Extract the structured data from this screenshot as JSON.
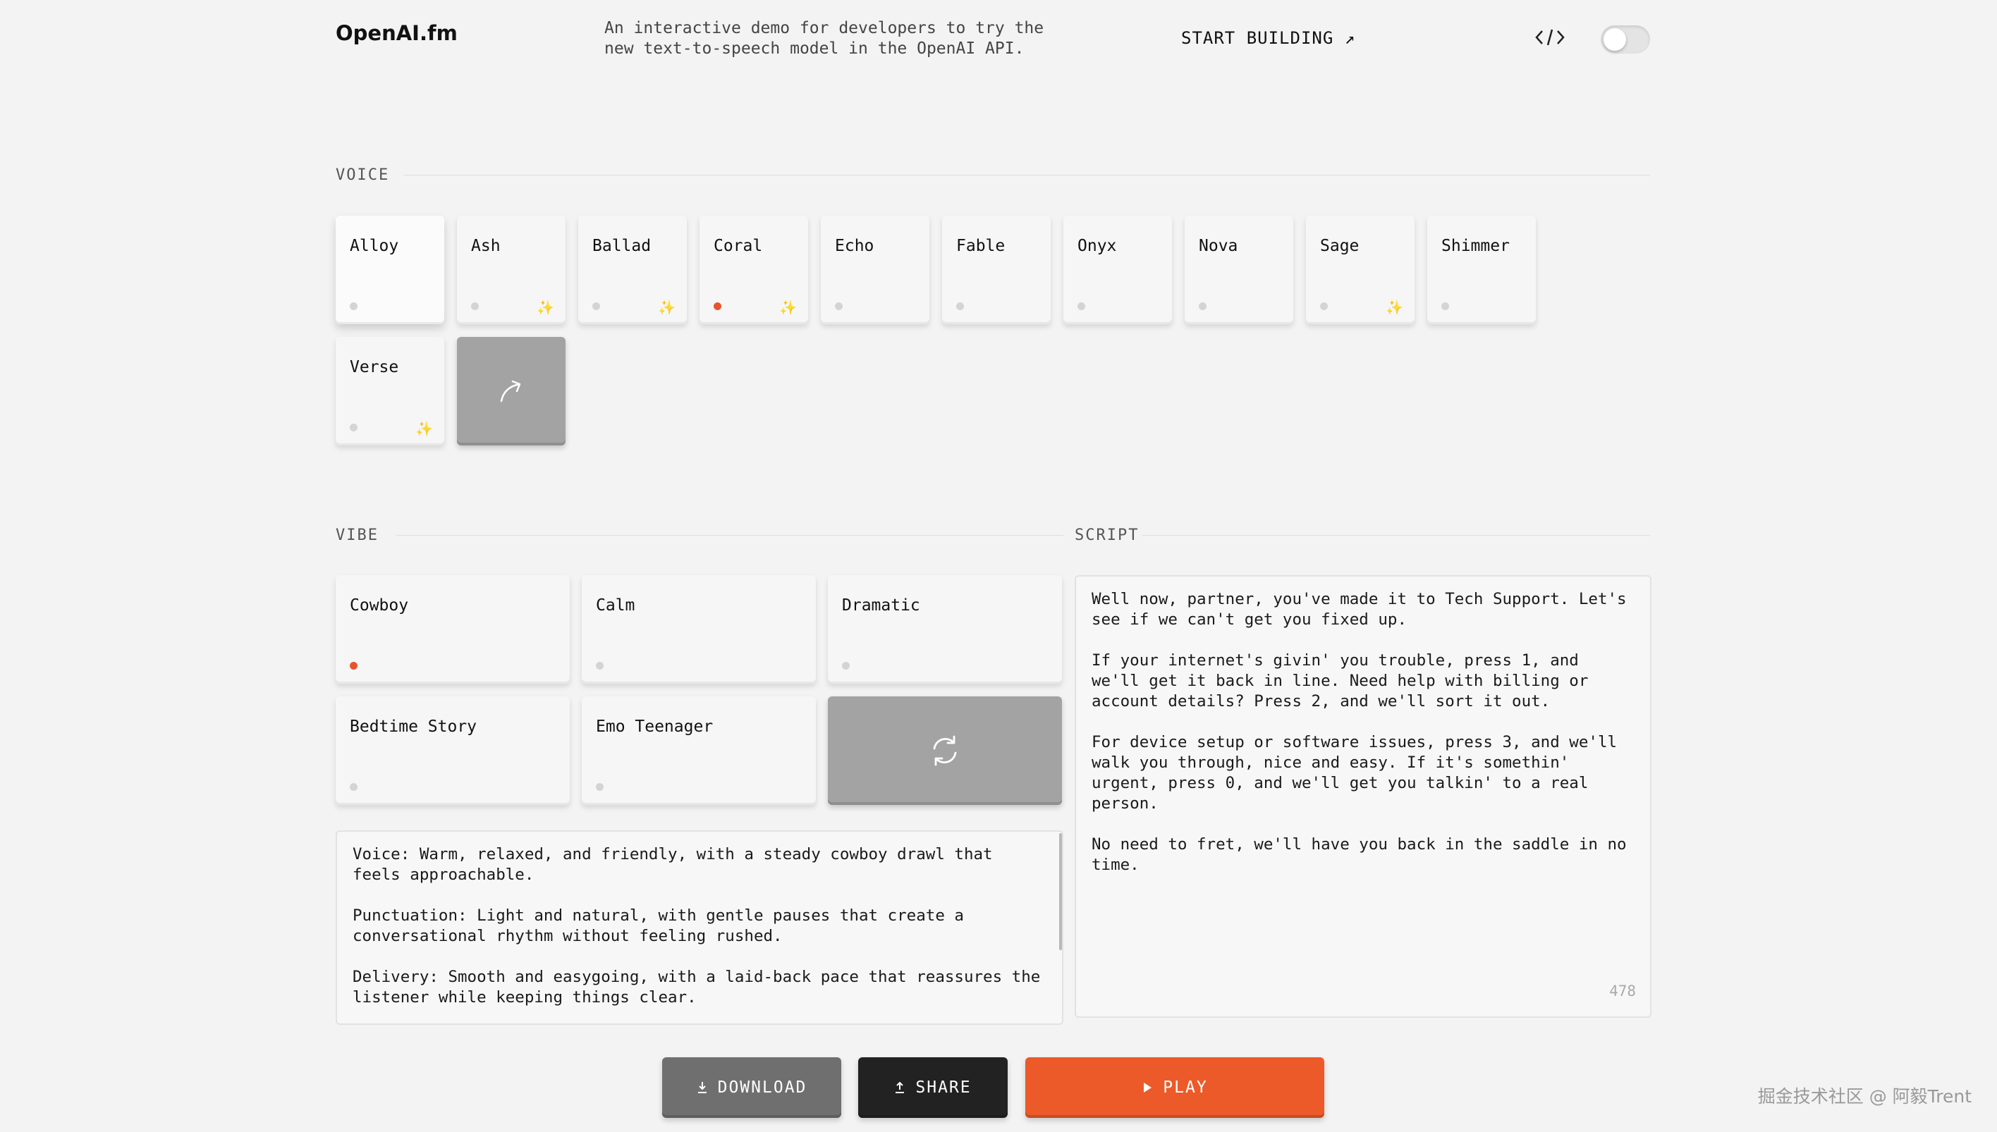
{
  "header": {
    "logo": "OpenAI.fm",
    "tagline": "An interactive demo for developers to try the new text-to-speech model in the OpenAI API.",
    "start_building": "START BUILDING ↗",
    "code_icon": "code-icon",
    "theme_toggle_on": false
  },
  "voice": {
    "label": "VOICE",
    "items": [
      {
        "name": "Alloy",
        "active": false,
        "sparkle": false,
        "selected": true
      },
      {
        "name": "Ash",
        "active": false,
        "sparkle": true
      },
      {
        "name": "Ballad",
        "active": false,
        "sparkle": true
      },
      {
        "name": "Coral",
        "active": true,
        "sparkle": true
      },
      {
        "name": "Echo",
        "active": false,
        "sparkle": false
      },
      {
        "name": "Fable",
        "active": false,
        "sparkle": false
      },
      {
        "name": "Onyx",
        "active": false,
        "sparkle": false
      },
      {
        "name": "Nova",
        "active": false,
        "sparkle": false
      },
      {
        "name": "Sage",
        "active": false,
        "sparkle": true
      },
      {
        "name": "Shimmer",
        "active": false,
        "sparkle": false
      },
      {
        "name": "Verse",
        "active": false,
        "sparkle": true
      }
    ],
    "more_icon": "arrow-up-right-icon",
    "sparkle_glyph": "✨"
  },
  "vibe": {
    "label": "VIBE",
    "items": [
      {
        "name": "Cowboy",
        "active": true
      },
      {
        "name": "Calm",
        "active": false
      },
      {
        "name": "Dramatic",
        "active": false
      },
      {
        "name": "Bedtime Story",
        "active": false
      },
      {
        "name": "Emo Teenager",
        "active": false
      }
    ],
    "shuffle_icon": "refresh-icon",
    "description": "Voice: Warm, relaxed, and friendly, with a steady cowboy drawl that feels approachable.\n\nPunctuation: Light and natural, with gentle pauses that create a conversational rhythm without feeling rushed.\n\nDelivery: Smooth and easygoing, with a laid-back pace that reassures the listener while keeping things clear."
  },
  "script": {
    "label": "SCRIPT",
    "text": "Well now, partner, you've made it to Tech Support. Let's see if we can't get you fixed up.\n\nIf your internet's givin' you trouble, press 1, and we'll get it back in line. Need help with billing or account details? Press 2, and we'll sort it out.\n\nFor device setup or software issues, press 3, and we'll walk you through, nice and easy. If it's somethin' urgent, press 0, and we'll get you talkin' to a real person.\n\nNo need to fret, we'll have you back in the saddle in no time.",
    "char_count": "478"
  },
  "actions": {
    "download": "DOWNLOAD",
    "share": "SHARE",
    "play": "PLAY"
  },
  "colors": {
    "accent": "#ec5a29",
    "background": "#f3f3f3",
    "card": "#f6f6f6",
    "dark_card": "#a3a3a3"
  },
  "watermark": "掘金技术社区 @ 阿毅Trent"
}
